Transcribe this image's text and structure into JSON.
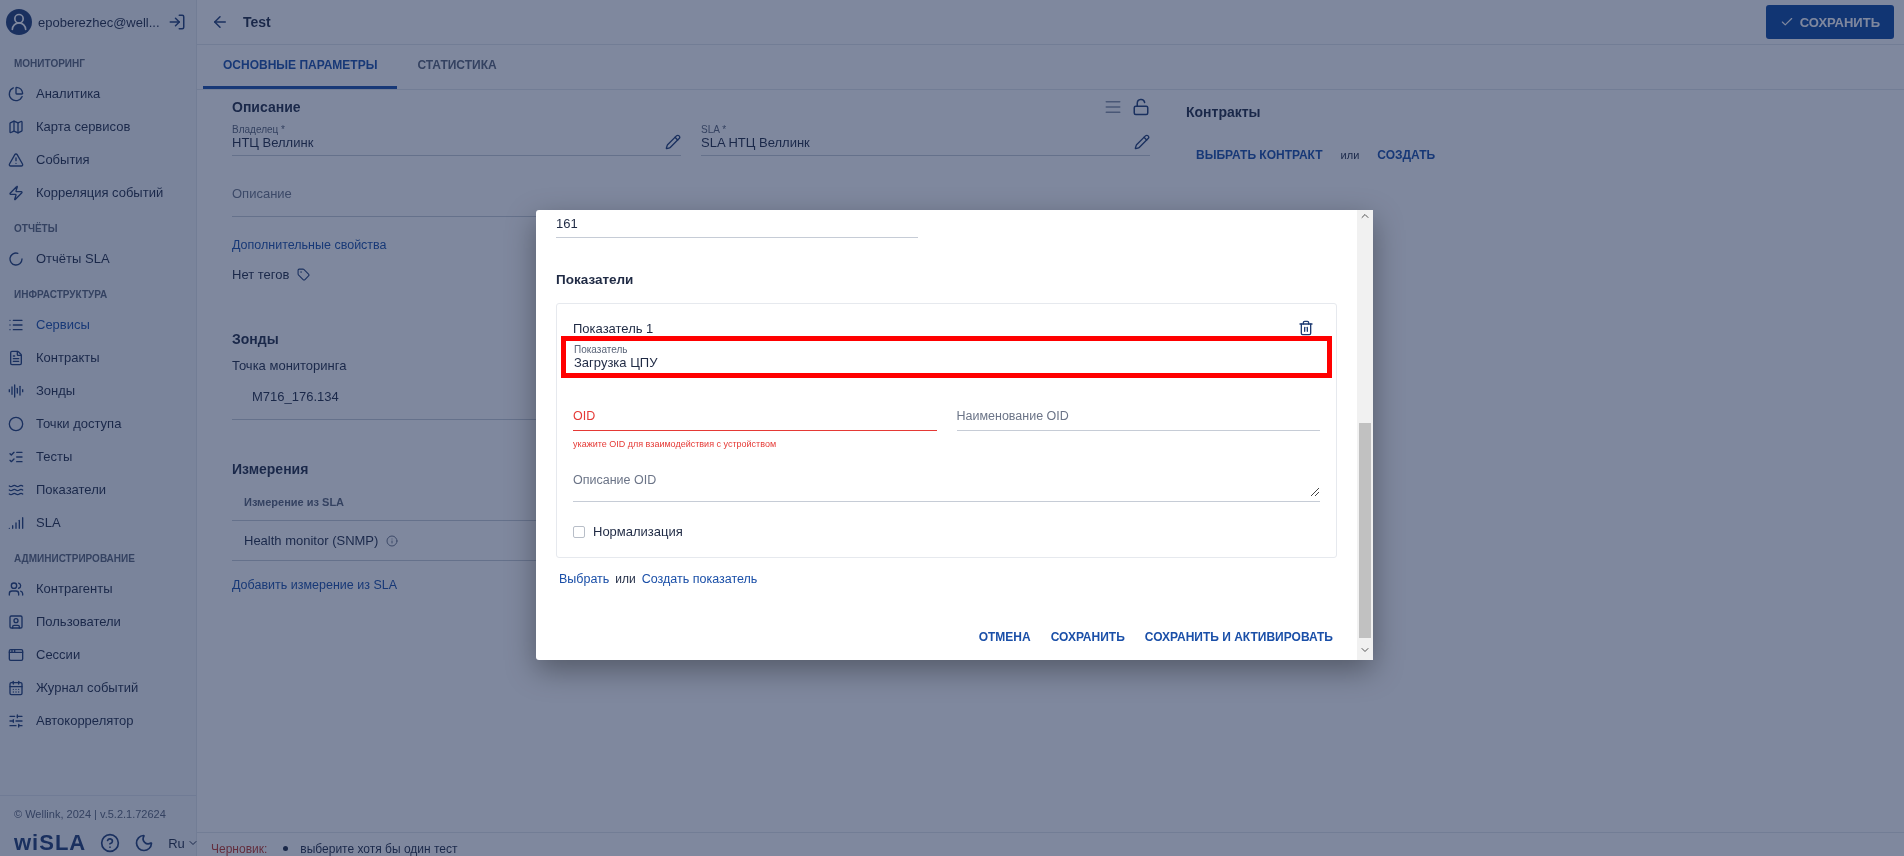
{
  "sidebar": {
    "user": "epoberezhec@well...",
    "sections": [
      {
        "title": "МОНИТОРИНГ",
        "items": [
          {
            "label": "Аналитика",
            "selected": false
          },
          {
            "label": "Карта сервисов",
            "selected": false
          },
          {
            "label": "События",
            "selected": false
          },
          {
            "label": "Корреляция событий",
            "selected": false
          }
        ]
      },
      {
        "title": "ОТЧЁТЫ",
        "items": [
          {
            "label": "Отчёты SLA",
            "selected": false
          }
        ]
      },
      {
        "title": "ИНФРАСТРУКТУРА",
        "items": [
          {
            "label": "Сервисы",
            "selected": true
          },
          {
            "label": "Контракты",
            "selected": false
          },
          {
            "label": "Зонды",
            "selected": false
          },
          {
            "label": "Точки доступа",
            "selected": false
          },
          {
            "label": "Тесты",
            "selected": false
          },
          {
            "label": "Показатели",
            "selected": false
          },
          {
            "label": "SLA",
            "selected": false
          }
        ]
      },
      {
        "title": "АДМИНИСТРИРОВАНИЕ",
        "items": [
          {
            "label": "Контрагенты",
            "selected": false
          },
          {
            "label": "Пользователи",
            "selected": false
          },
          {
            "label": "Сессии",
            "selected": false
          },
          {
            "label": "Журнал событий",
            "selected": false
          },
          {
            "label": "Автокоррелятор",
            "selected": false
          }
        ]
      }
    ],
    "footer": "© Wellink, 2024 | v.5.2.1.72624",
    "logo": "wiSLA",
    "language": "Ru"
  },
  "header": {
    "title": "Test",
    "save_button": "СОХРАНИТЬ"
  },
  "tabs": [
    {
      "label": "ОСНОВНЫЕ ПАРАМЕТРЫ",
      "selected": true
    },
    {
      "label": "СТАТИСТИКА",
      "selected": false
    }
  ],
  "description": {
    "title": "Описание",
    "fields": [
      {
        "label": "Владелец *",
        "value": "НТЦ Веллинк"
      },
      {
        "label": "SLA *",
        "value": "SLA НТЦ Веллинк"
      }
    ],
    "description_placeholder": "Описание",
    "extra_link": "Дополнительные свойства",
    "tags_text": "Нет тегов"
  },
  "probes": {
    "title": "Зонды",
    "label": "Точка мониторинга",
    "value": "M716_176.134"
  },
  "measurements": {
    "title": "Измерения",
    "column": "Измерение из SLA",
    "rows": [
      "Health monitor (SNMP)"
    ],
    "add_link": "Добавить измерение из SLA"
  },
  "contracts": {
    "title": "Контракты",
    "select": "ВЫБРАТЬ КОНТРАКТ",
    "or": "или",
    "create": "СОЗДАТЬ"
  },
  "status_bar": {
    "label": "Черновик:",
    "messages": [
      "выберите хотя бы один тест"
    ]
  },
  "dialog": {
    "top_value": "161",
    "section_title": "Показатели",
    "indicators": [
      {
        "title": "Показатель 1",
        "field": {
          "label": "Показатель",
          "value": "Загрузка ЦПУ",
          "highlighted": true
        },
        "oid": {
          "placeholder": "OID",
          "error": "укажите OID для взаимодействия с устройством"
        },
        "oid_name": {
          "placeholder": "Наименование OID"
        },
        "oid_description": {
          "placeholder": "Описание OID"
        },
        "normalization": {
          "label": "Нормализация",
          "checked": false
        }
      }
    ],
    "select_link": "Выбрать",
    "or": "или",
    "create_link": "Создать показатель",
    "buttons": [
      "ОТМЕНА",
      "СОХРАНИТЬ",
      "СОХРАНИТЬ И АКТИВИРОВАТЬ"
    ]
  }
}
